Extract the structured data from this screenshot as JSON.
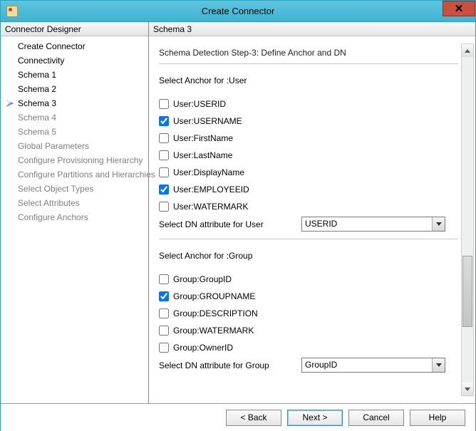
{
  "window": {
    "title": "Create Connector"
  },
  "sidebar": {
    "header": "Connector Designer",
    "items": [
      {
        "label": "Create Connector",
        "state": "past"
      },
      {
        "label": "Connectivity",
        "state": "past"
      },
      {
        "label": "Schema 1",
        "state": "past"
      },
      {
        "label": "Schema 2",
        "state": "past"
      },
      {
        "label": "Schema 3",
        "state": "current"
      },
      {
        "label": "Schema 4",
        "state": "future"
      },
      {
        "label": "Schema 5",
        "state": "future"
      },
      {
        "label": "Global Parameters",
        "state": "future"
      },
      {
        "label": "Configure Provisioning Hierarchy",
        "state": "future"
      },
      {
        "label": "Configure Partitions and Hierarchies",
        "state": "future"
      },
      {
        "label": "Select Object Types",
        "state": "future"
      },
      {
        "label": "Select Attributes",
        "state": "future"
      },
      {
        "label": "Configure Anchors",
        "state": "future"
      }
    ]
  },
  "content": {
    "header": "Schema 3",
    "step_title": "Schema Detection Step-3: Define Anchor and DN",
    "user": {
      "section_label": "Select Anchor for :User",
      "items": [
        {
          "label": "User:USERID",
          "checked": false
        },
        {
          "label": "User:USERNAME",
          "checked": true
        },
        {
          "label": "User:FirstName",
          "checked": false
        },
        {
          "label": "User:LastName",
          "checked": false
        },
        {
          "label": "User:DisplayName",
          "checked": false
        },
        {
          "label": "User:EMPLOYEEID",
          "checked": true
        },
        {
          "label": "User:WATERMARK",
          "checked": false
        }
      ],
      "dn_label": "Select DN attribute for User",
      "dn_value": "USERID"
    },
    "group": {
      "section_label": "Select Anchor for :Group",
      "items": [
        {
          "label": "Group:GroupID",
          "checked": false
        },
        {
          "label": "Group:GROUPNAME",
          "checked": true
        },
        {
          "label": "Group:DESCRIPTION",
          "checked": false
        },
        {
          "label": "Group:WATERMARK",
          "checked": false
        },
        {
          "label": "Group:OwnerID",
          "checked": false
        }
      ],
      "dn_label": "Select DN attribute for Group",
      "dn_value": "GroupID"
    }
  },
  "buttons": {
    "back": "<  Back",
    "next": "Next  >",
    "cancel": "Cancel",
    "help": "Help"
  }
}
